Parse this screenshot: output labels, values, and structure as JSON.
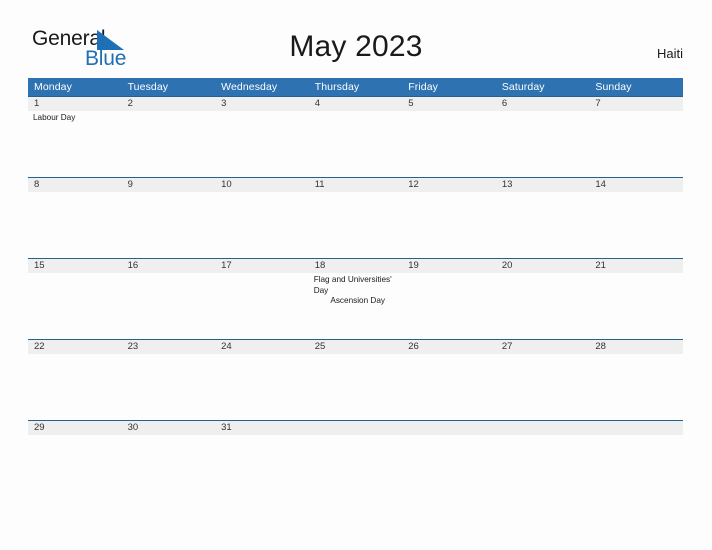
{
  "logo": {
    "word_one": "General",
    "word_two": "Blue",
    "triangle_icon": "triangle-icon",
    "accent_color": "#1f6fb5"
  },
  "header": {
    "title": "May 2023",
    "country": "Haiti"
  },
  "theme": {
    "header_blue": "#2e72b2",
    "band_gray": "#efefef",
    "band_border": "#23618f",
    "page_background": "#fdfdfd",
    "text_color": "#1a1a1a"
  },
  "calendar": {
    "month": "May",
    "year": "2023",
    "weekdays": [
      "Monday",
      "Tuesday",
      "Wednesday",
      "Thursday",
      "Friday",
      "Saturday",
      "Sunday"
    ],
    "weeks": [
      [
        {
          "day": "1",
          "events": [
            {
              "text": "Labour Day",
              "align": "left"
            }
          ]
        },
        {
          "day": "2",
          "events": []
        },
        {
          "day": "3",
          "events": []
        },
        {
          "day": "4",
          "events": []
        },
        {
          "day": "5",
          "events": []
        },
        {
          "day": "6",
          "events": []
        },
        {
          "day": "7",
          "events": []
        }
      ],
      [
        {
          "day": "8",
          "events": []
        },
        {
          "day": "9",
          "events": []
        },
        {
          "day": "10",
          "events": []
        },
        {
          "day": "11",
          "events": []
        },
        {
          "day": "12",
          "events": []
        },
        {
          "day": "13",
          "events": []
        },
        {
          "day": "14",
          "events": []
        }
      ],
      [
        {
          "day": "15",
          "events": []
        },
        {
          "day": "16",
          "events": []
        },
        {
          "day": "17",
          "events": []
        },
        {
          "day": "18",
          "events": [
            {
              "text": "Flag and Universities' Day",
              "align": "left"
            },
            {
              "text": "Ascension Day",
              "align": "center"
            }
          ]
        },
        {
          "day": "19",
          "events": []
        },
        {
          "day": "20",
          "events": []
        },
        {
          "day": "21",
          "events": []
        }
      ],
      [
        {
          "day": "22",
          "events": []
        },
        {
          "day": "23",
          "events": []
        },
        {
          "day": "24",
          "events": []
        },
        {
          "day": "25",
          "events": []
        },
        {
          "day": "26",
          "events": []
        },
        {
          "day": "27",
          "events": []
        },
        {
          "day": "28",
          "events": []
        }
      ],
      [
        {
          "day": "29",
          "events": []
        },
        {
          "day": "30",
          "events": []
        },
        {
          "day": "31",
          "events": []
        },
        {
          "day": "",
          "events": []
        },
        {
          "day": "",
          "events": []
        },
        {
          "day": "",
          "events": []
        },
        {
          "day": "",
          "events": []
        }
      ]
    ]
  }
}
